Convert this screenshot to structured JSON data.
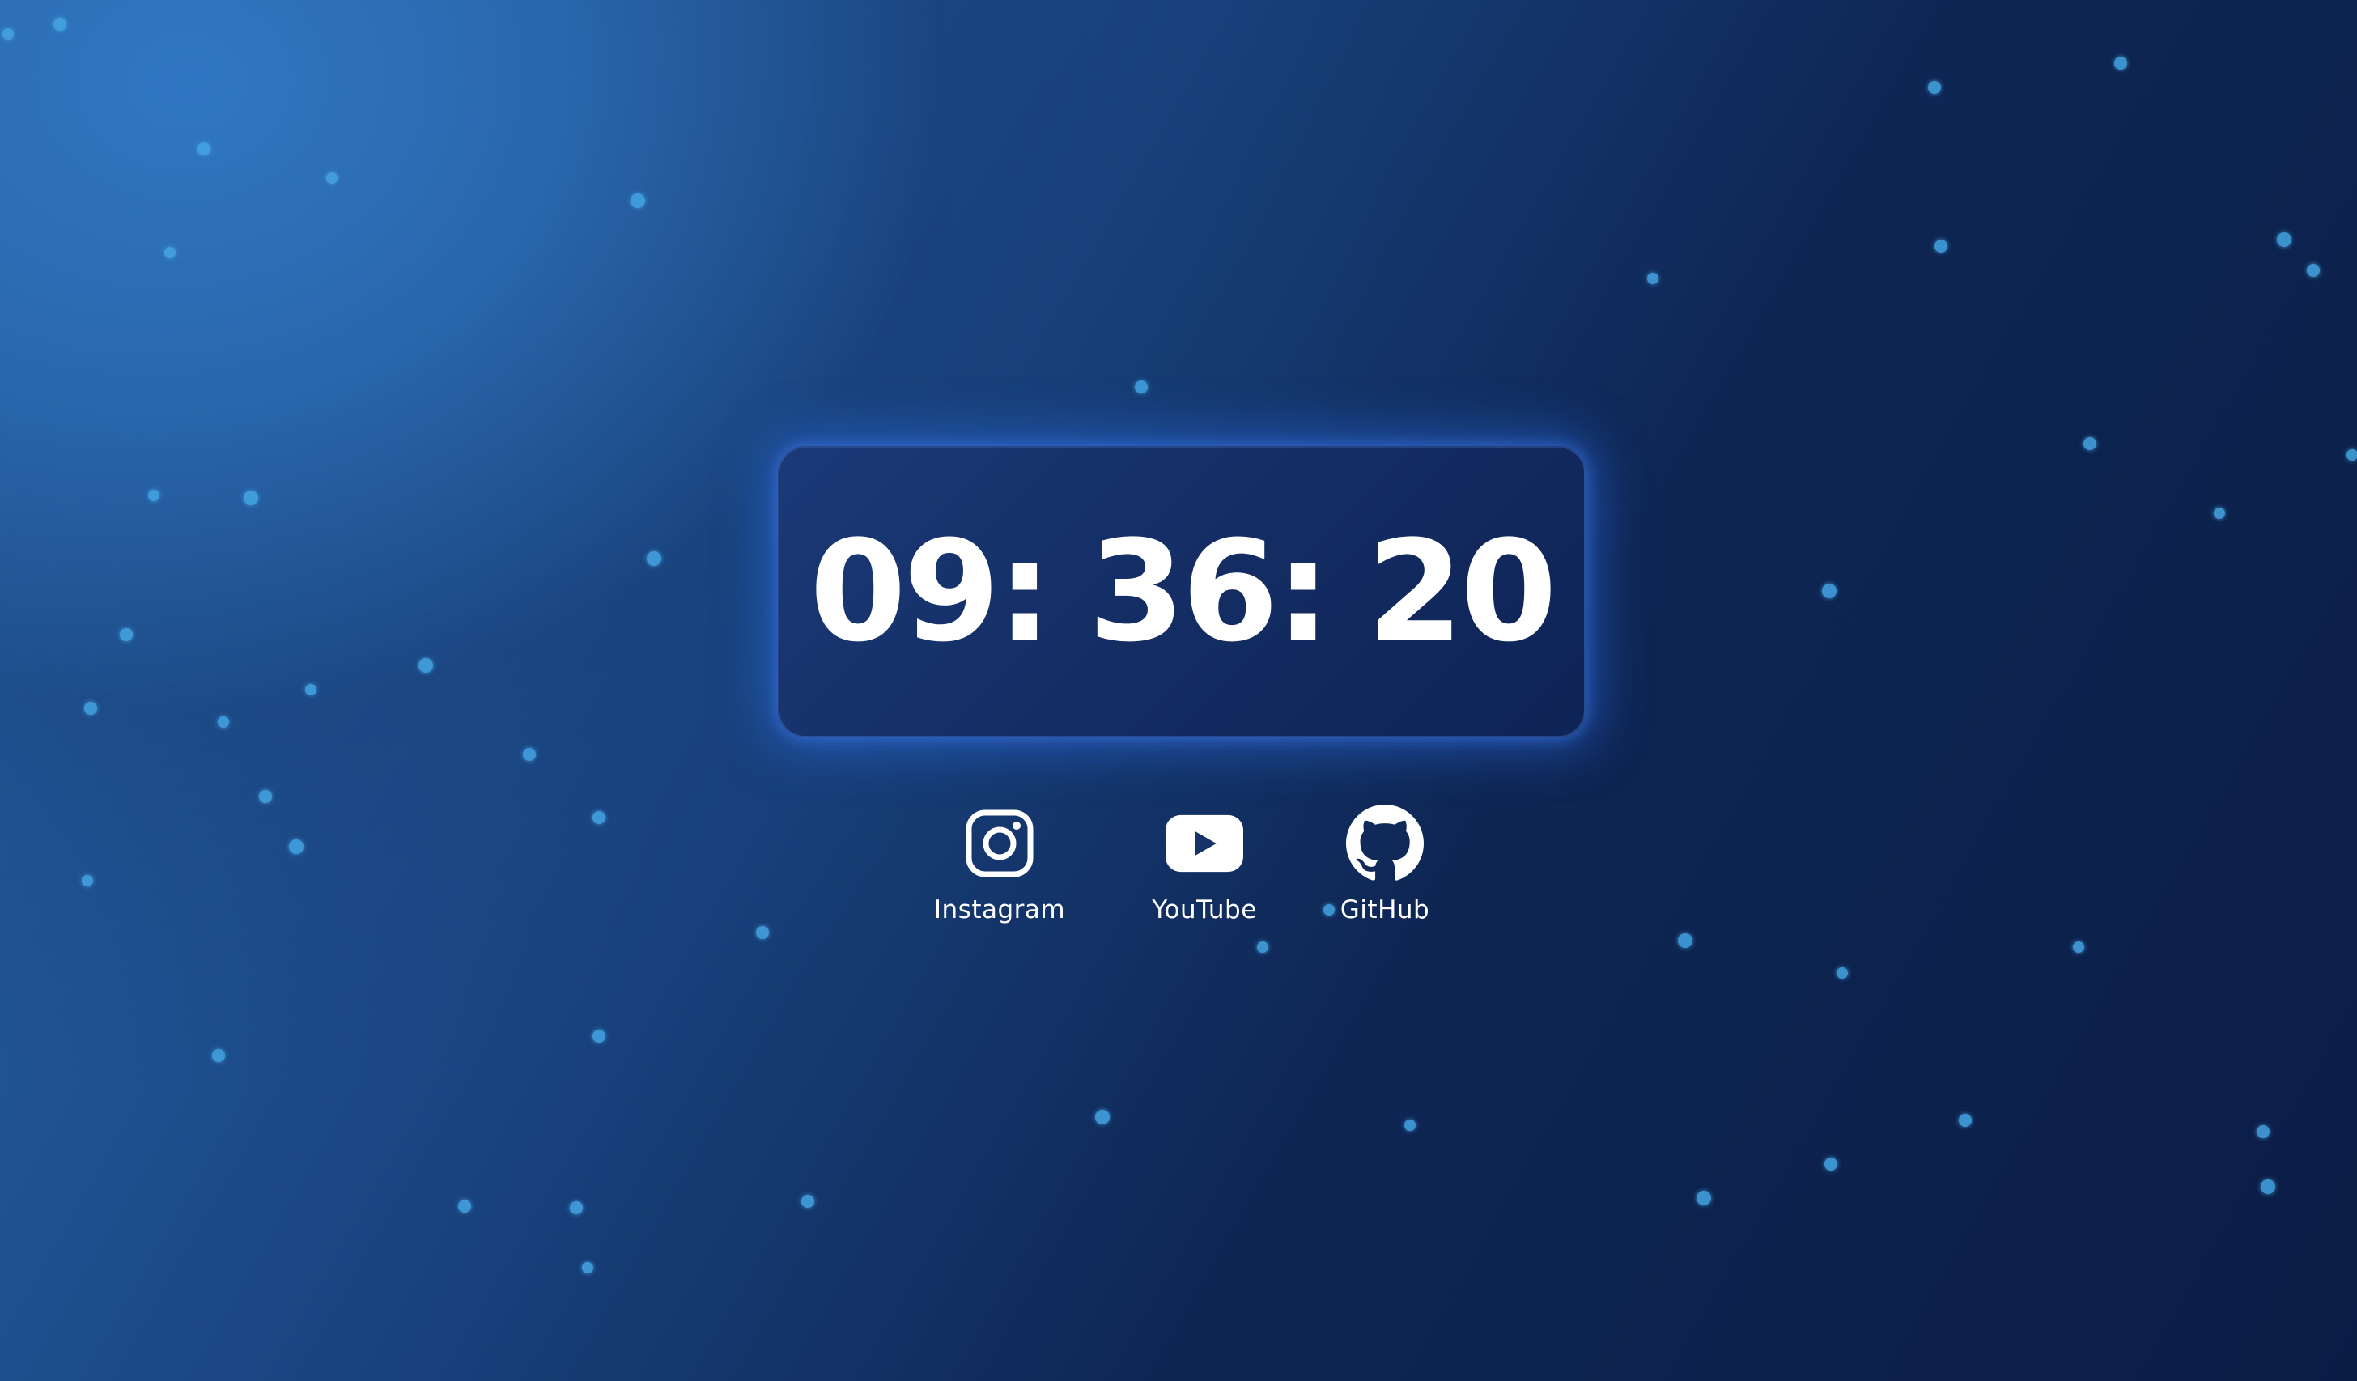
{
  "clock": {
    "hours": "09",
    "minutes": "36",
    "seconds": "20",
    "separator": ":"
  },
  "social_links": [
    {
      "label": "Instagram",
      "icon": "instagram-icon"
    },
    {
      "label": "YouTube",
      "icon": "youtube-icon"
    },
    {
      "label": "GitHub",
      "icon": "github-icon"
    }
  ],
  "colors": {
    "background_light": "#2f76c2",
    "background_dark": "#0b1d45",
    "card": "#132c62",
    "card_glow": "#2e6ee6",
    "particle": "#45a6e4",
    "text": "#ffffff"
  }
}
